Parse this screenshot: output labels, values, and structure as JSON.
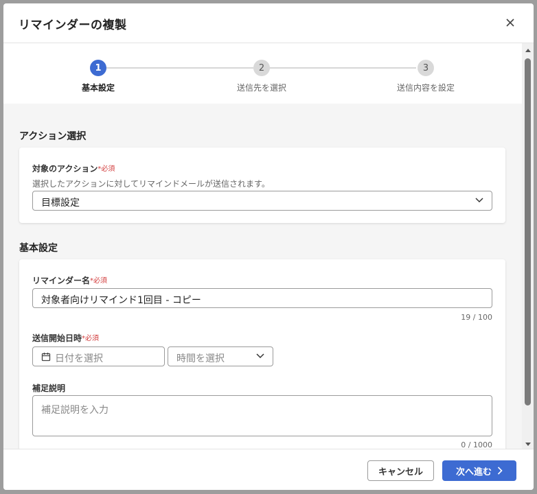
{
  "dialog": {
    "title": "リマインダーの複製"
  },
  "stepper": {
    "steps": [
      {
        "number": "1",
        "label": "基本設定",
        "active": true
      },
      {
        "number": "2",
        "label": "送信先を選択",
        "active": false
      },
      {
        "number": "3",
        "label": "送信内容を設定",
        "active": false
      }
    ]
  },
  "action_section": {
    "title": "アクション選択",
    "target_label": "対象のアクション",
    "required_mark": "*必須",
    "help_text": "選択したアクションに対してリマインドメールが送信されます。",
    "selected_action": "目標設定"
  },
  "basic_section": {
    "title": "基本設定",
    "name_label": "リマインダー名",
    "name_required": "*必須",
    "name_value": "対象者向けリマインド1回目 - コピー",
    "name_counter": "19 / 100",
    "start_label": "送信開始日時",
    "start_required": "*必須",
    "date_placeholder": "日付を選択",
    "time_placeholder": "時間を選択",
    "note_label": "補足説明",
    "note_placeholder": "補足説明を入力",
    "note_counter": "0 / 1000"
  },
  "footer": {
    "cancel_label": "キャンセル",
    "next_label": "次へ進む"
  },
  "colors": {
    "primary": "#3d6bd2",
    "required": "#d23c3c"
  }
}
